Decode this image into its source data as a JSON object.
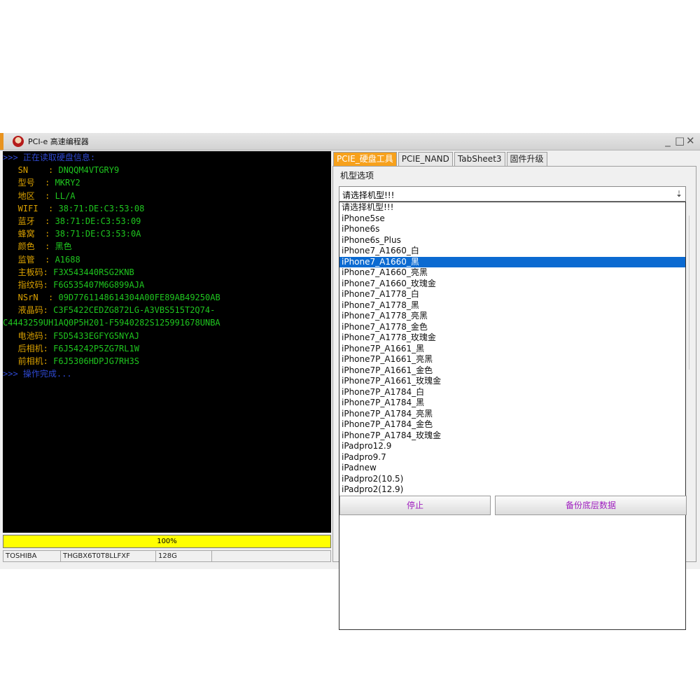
{
  "window": {
    "title": "PCI-e 高速编程器",
    "controls": [
      "_",
      "□",
      "✕"
    ]
  },
  "console": {
    "lines": [
      {
        "label": ">>> 正在读取硬盘信息:",
        "value": "",
        "label_color": "blue"
      },
      {
        "label": "   SN    : ",
        "value": "DNQQM4VTGRY9"
      },
      {
        "label": "   型号  : ",
        "value": "MKRY2"
      },
      {
        "label": "   地区  : ",
        "value": "LL/A"
      },
      {
        "label": "   WIFI  : ",
        "value": "38:71:DE:C3:53:08"
      },
      {
        "label": "   蓝牙  : ",
        "value": "38:71:DE:C3:53:09"
      },
      {
        "label": "   蜂窝  : ",
        "value": "38:71:DE:C3:53:0A"
      },
      {
        "label": "   颜色  : ",
        "value": "黑色"
      },
      {
        "label": "   监管  : ",
        "value": "A1688"
      },
      {
        "label": "   主板码: ",
        "value": "F3X543440RSG2KNB"
      },
      {
        "label": "   指纹码: ",
        "value": "F6G535407M6G899AJA"
      },
      {
        "label": "   NSrN  : ",
        "value": "09D7761148614304A00FE89AB49250AB"
      },
      {
        "label": "   液晶码: ",
        "value": "C3F5422CEDZG872LG-A3VBS515T2Q74-"
      },
      {
        "label": "",
        "value": "C4443259UH1AQ0P5H201-F5940282S125991678UNBA"
      },
      {
        "label": "   电池码: ",
        "value": "F5D5433EGFYG5NYAJ"
      },
      {
        "label": "   后相机: ",
        "value": "F6J54242P5ZG7RL1W"
      },
      {
        "label": "   前相机: ",
        "value": "F6J5306HDPJG7RH3S"
      },
      {
        "label": ">>> 操作完成...",
        "value": "",
        "label_color": "blue"
      }
    ]
  },
  "progress": {
    "text": "100%",
    "value": 1.0
  },
  "statusbar": [
    "TOSHIBA",
    "THGBX6T0T8LLFXF",
    "128G",
    ""
  ],
  "tabs": [
    "PCIE_硬盘工具",
    "PCIE_NAND",
    "TabSheet3",
    "固件升级"
  ],
  "active_tab": 0,
  "model_group": {
    "label": "机型选项",
    "selected": "请选择机型!!!",
    "highlighted_index": 5,
    "options": [
      "请选择机型!!!",
      "iPhone5se",
      "iPhone6s",
      "iPhone6s_Plus",
      "iPhone7_A1660_白",
      "iPhone7_A1660_黑",
      "iPhone7_A1660_亮黑",
      "iPhone7_A1660_玫瑰金",
      "iPhone7_A1778_白",
      "iPhone7_A1778_黑",
      "iPhone7_A1778_亮黑",
      "iPhone7_A1778_金色",
      "iPhone7_A1778_玫瑰金",
      "iPhone7P_A1661_黑",
      "iPhone7P_A1661_亮黑",
      "iPhone7P_A1661_金色",
      "iPhone7P_A1661_玫瑰金",
      "iPhone7P_A1784_白",
      "iPhone7P_A1784_黑",
      "iPhone7P_A1784_亮黑",
      "iPhone7P_A1784_金色",
      "iPhone7P_A1784_玫瑰金",
      "iPadpro12.9",
      "iPadpro9.7",
      "iPadnew",
      "iPadpro2(10.5)",
      "iPadpro2(12.9)"
    ]
  },
  "buttons": {
    "stop": "停止",
    "backup": "备份底层数据"
  },
  "colors": {
    "accent": "#f7a11c",
    "progress": "#ffff00",
    "selection": "#0b6ad1",
    "label": "#d9a000",
    "value": "#1fc61f",
    "info": "#2e48d0",
    "button_text": "#a020c0"
  }
}
